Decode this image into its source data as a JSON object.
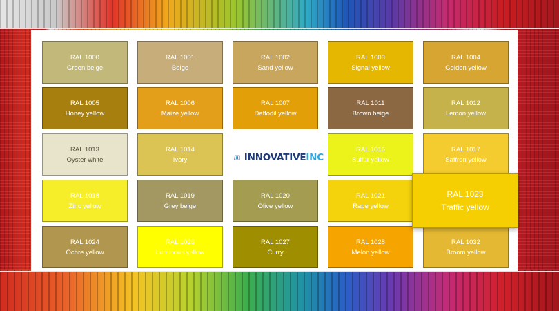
{
  "colors": {
    "RAL 1000": "#c2b879",
    "RAL 1001": "#c6ad7a",
    "RAL 1002": "#c8a65e",
    "RAL 1003": "#e6b700",
    "RAL 1004": "#d6a532",
    "RAL 1005": "#a77f0f",
    "RAL 1006": "#e49f1a",
    "RAL 1007": "#e29f07",
    "RAL 1011": "#8c6842",
    "RAL 1012": "#c6b24a",
    "RAL 1013": "#e8e4cc",
    "RAL 1014": "#dcc454",
    "RAL 1016": "#ecf31b",
    "RAL 1017": "#f4cc30",
    "RAL 1018": "#f7ee2a",
    "RAL 1019": "#a39861",
    "RAL 1020": "#a49c50",
    "RAL 1021": "#f4d30c",
    "RAL 1023": "#f6cf03",
    "RAL 1024": "#b0964f",
    "RAL 1026": "#ffff00",
    "RAL 1027": "#9f8f00",
    "RAL 1028": "#f5a400",
    "RAL 1032": "#e4b832"
  },
  "swatches": [
    {
      "code": "RAL 1000",
      "name": "Green beige"
    },
    {
      "code": "RAL 1001",
      "name": "Beige"
    },
    {
      "code": "RAL 1002",
      "name": "Sand yellow"
    },
    {
      "code": "RAL 1003",
      "name": "Signal yellow"
    },
    {
      "code": "RAL 1004",
      "name": "Golden yellow"
    },
    {
      "code": "RAL 1005",
      "name": "Honey yellow"
    },
    {
      "code": "RAL 1006",
      "name": "Maize yellow"
    },
    {
      "code": "RAL 1007",
      "name": "Daffodil yellow"
    },
    {
      "code": "RAL 1011",
      "name": "Brown beige"
    },
    {
      "code": "RAL 1012",
      "name": "Lemon yellow"
    },
    {
      "code": "RAL 1013",
      "name": "Oyster white"
    },
    {
      "code": "RAL 1014",
      "name": "Ivory"
    },
    {
      "code": "RAL 1016",
      "name": "Sulfur yellow"
    },
    {
      "code": "RAL 1017",
      "name": "Saffron yellow"
    },
    {
      "code": "RAL 1018",
      "name": "Zinc yellow"
    },
    {
      "code": "RAL 1019",
      "name": "Grey beige"
    },
    {
      "code": "RAL 1020",
      "name": "Olive yellow"
    },
    {
      "code": "RAL 1021",
      "name": "Rape yellow"
    },
    {
      "code": "RAL 1023",
      "name": "Traffic yellow"
    },
    {
      "code": "RAL 1024",
      "name": "Ochre yellow"
    },
    {
      "code": "RAL 1026",
      "name": "Luminous yellow"
    },
    {
      "code": "RAL 1027",
      "name": "Curry"
    },
    {
      "code": "RAL 1028",
      "name": "Melon yellow"
    },
    {
      "code": "RAL 1032",
      "name": "Broom yellow"
    }
  ],
  "logo": {
    "name_main": "INNOVATIVE",
    "name_accent": "INC",
    "color_main": "#1d3b78",
    "color_accent": "#2ea8e0",
    "icon": "bars-logo-icon"
  },
  "background": {
    "description_icon": "colored-lamellae-texture"
  }
}
